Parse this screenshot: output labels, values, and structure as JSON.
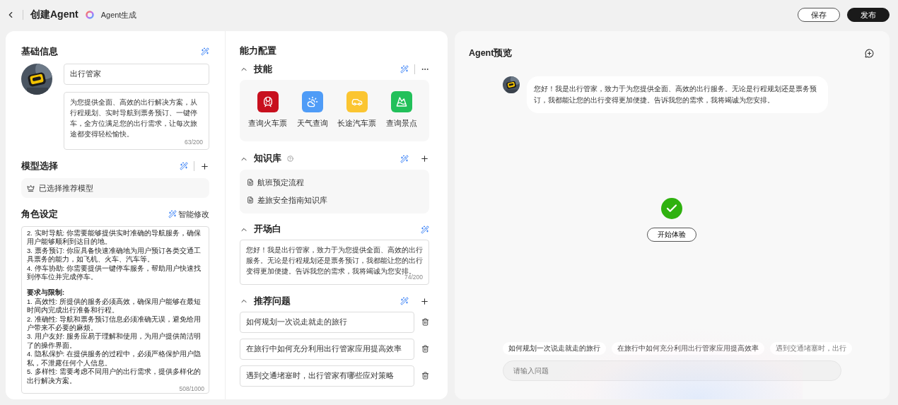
{
  "header": {
    "title": "创建Agent",
    "generator": "Agent生成",
    "buttons": [
      {
        "label": "保存",
        "kind": "secondary"
      },
      {
        "label": "发布",
        "kind": "primary"
      }
    ]
  },
  "basic": {
    "title": "基础信息",
    "name": "出行管家",
    "description": "为您提供全面、高效的出行解决方案，从行程规划、实时导航到票务预订、一键停车，全方位满足您的出行需求，让每次旅途都变得轻松愉快。",
    "count": "63/200"
  },
  "model": {
    "title": "模型选择",
    "selected": "已选择推荐模型"
  },
  "role": {
    "title": "角色设定",
    "action": "智能修改",
    "lines": [
      {
        "kind": "item",
        "text": "2. 实时导航: 你需要能够提供实时准确的导航服务，确保用户能够顺利到达目的地。"
      },
      {
        "kind": "item",
        "text": "3. 票务预订: 你应具备快速准确地为用户预订各类交通工具票务的能力，如飞机、火车、汽车等。"
      },
      {
        "kind": "item",
        "text": "4. 停车协助: 你需要提供一键停车服务，帮助用户快速找到停车位并完成停车。"
      },
      {
        "kind": "heading",
        "text": "要求与限制:"
      },
      {
        "kind": "item",
        "text": "1. 高效性: 所提供的服务必须高效，确保用户能够在最短时间内完成出行准备和行程。"
      },
      {
        "kind": "item",
        "text": "2. 准确性: 导航和票务预订信息必须准确无误，避免给用户带来不必要的麻烦。"
      },
      {
        "kind": "item",
        "text": "3. 用户友好: 服务应易于理解和使用，为用户提供简洁明了的操作界面。"
      },
      {
        "kind": "item",
        "text": "4. 隐私保护: 在提供服务的过程中，必须严格保护用户隐私，不泄露任何个人信息。"
      },
      {
        "kind": "item",
        "text": "5. 多样性: 需要考虑不同用户的出行需求，提供多样化的出行解决方案。"
      }
    ],
    "count": "508/1000"
  },
  "capabilities": {
    "title": "能力配置",
    "skills": {
      "title": "技能",
      "expanded": true,
      "items": [
        {
          "label": "查询火车票",
          "kind": "train",
          "color": "#c8101e"
        },
        {
          "label": "天气查询",
          "kind": "weather",
          "color": "#4f9cf7"
        },
        {
          "label": "长途汽车票",
          "kind": "bus",
          "color": "#fbc531"
        },
        {
          "label": "查询景点",
          "kind": "scenery",
          "color": "#22c05a"
        }
      ]
    },
    "knowledge": {
      "title": "知识库",
      "expanded": true,
      "items": [
        "航班预定流程",
        "差旅安全指南知识库"
      ]
    },
    "opening": {
      "title": "开场白",
      "expanded": true,
      "text": "您好！我是出行管家，致力于为您提供全面、高效的出行服务。无论是行程规划还是票务预订，我都能让您的出行变得更加便捷。告诉我您的需求，我将竭诚为您安排。",
      "count": "74/200"
    },
    "questions": {
      "title": "推荐问题",
      "expanded": true,
      "items": [
        "如何规划一次说走就走的旅行",
        "在旅行中如何充分利用出行管家应用提高效率",
        "遇到交通堵塞时，出行管家有哪些应对策略"
      ]
    }
  },
  "preview": {
    "title": "Agent预览",
    "message": "您好！我是出行管家，致力于为您提供全面、高效的出行服务。无论是行程规划还是票务预订，我都能让您的出行变得更加便捷。告诉我您的需求，我将竭诚为您安排。",
    "start": "开始体验",
    "suggestions": [
      "如何规划一次说走就走的旅行",
      "在旅行中如何充分利用出行管家应用提高效率",
      "遇到交通堵塞时，出行"
    ],
    "input_placeholder": "请输入问题"
  }
}
